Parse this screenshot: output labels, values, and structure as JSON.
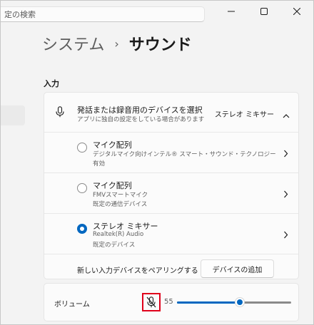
{
  "search": {
    "placeholder": "定の検索"
  },
  "window_controls": [
    "minimize",
    "maximize",
    "close"
  ],
  "breadcrumb": {
    "parent": "システム",
    "separator": "›",
    "current": "サウンド"
  },
  "input_section": {
    "label": "入力",
    "header": {
      "title": "発話または録音用のデバイスを選択",
      "subtitle": "アプリに独自の設定をしている場合があります",
      "selected_value": "ステレオ ミキサー",
      "icon": "microphone-icon"
    },
    "devices": [
      {
        "name": "マイク配列",
        "lines": [
          "デジタルマイク向けインテル® スマート・サウンド・テクノロジー",
          "有効"
        ],
        "selected": false
      },
      {
        "name": "マイク配列",
        "lines": [
          "FMVスマートマイク",
          "既定の通信デバイス"
        ],
        "selected": false
      },
      {
        "name": "ステレオ ミキサー",
        "lines": [
          "Realtek(R) Audio",
          "既定のデバイス"
        ],
        "selected": true
      }
    ],
    "pair": {
      "label": "新しい入力デバイスをペアリングする",
      "button": "デバイスの追加"
    }
  },
  "volume": {
    "label": "ボリューム",
    "value": "55",
    "level": 0.55,
    "muted": true,
    "mute_icon": "microphone-muted-icon"
  },
  "colors": {
    "accent": "#0067c0",
    "highlight": "#e0001b"
  }
}
